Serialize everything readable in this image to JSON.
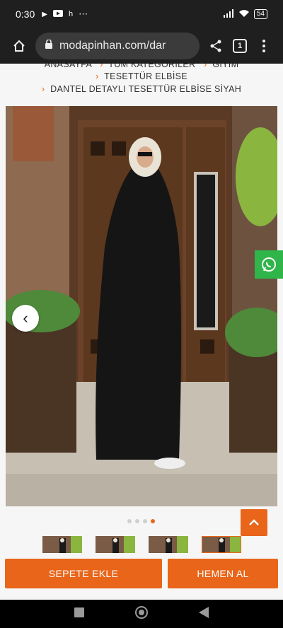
{
  "status": {
    "time": "0:30",
    "notif_icons": [
      "play-store-icon",
      "youtube-icon",
      "h-icon",
      "more-dots-icon"
    ],
    "battery": "54",
    "right_icons": [
      "signal-icon",
      "wifi-icon",
      "battery-icon"
    ]
  },
  "browser": {
    "url": "modapinhan.com/dar",
    "tab_count": "1"
  },
  "breadcrumb": {
    "row1": [
      "ANASAYFA",
      "TÜM KATEGORİLER",
      "GİYİM"
    ],
    "row2": "TESETTÜR ELBİSE",
    "row3": "DANTEL DETAYLI TESETTÜR ELBİSE SİYAH"
  },
  "gallery": {
    "dots_total": 4,
    "active_dot": 4,
    "thumbnail_count": 4
  },
  "actions": {
    "add_to_cart": "SEPETE EKLE",
    "buy_now": "HEMEN AL"
  },
  "colors": {
    "accent": "#e8651a",
    "whatsapp": "#2fb54a",
    "chrome": "#1f1f1f"
  }
}
